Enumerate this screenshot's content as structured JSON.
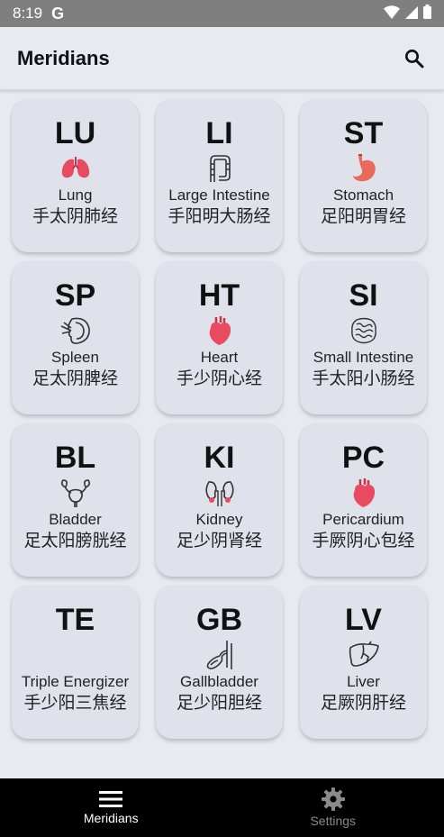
{
  "status_bar": {
    "time": "8:19",
    "notification": "G"
  },
  "app_bar": {
    "title": "Meridians"
  },
  "meridians": [
    {
      "code": "LU",
      "name": "Lung",
      "chinese": "手太阴肺经",
      "icon": "lungs-icon"
    },
    {
      "code": "LI",
      "name": "Large Intestine",
      "chinese": "手阳明大肠经",
      "icon": "large-intestine-icon"
    },
    {
      "code": "ST",
      "name": "Stomach",
      "chinese": "足阳明胃经",
      "icon": "stomach-icon"
    },
    {
      "code": "SP",
      "name": "Spleen",
      "chinese": "足太阴脾经",
      "icon": "spleen-icon"
    },
    {
      "code": "HT",
      "name": "Heart",
      "chinese": "手少阴心经",
      "icon": "heart-icon"
    },
    {
      "code": "SI",
      "name": "Small Intestine",
      "chinese": "手太阳小肠经",
      "icon": "small-intestine-icon"
    },
    {
      "code": "BL",
      "name": "Bladder",
      "chinese": "足太阳膀胱经",
      "icon": "bladder-icon"
    },
    {
      "code": "KI",
      "name": "Kidney",
      "chinese": "足少阴肾经",
      "icon": "kidney-icon"
    },
    {
      "code": "PC",
      "name": "Pericardium",
      "chinese": "手厥阴心包经",
      "icon": "pericardium-icon"
    },
    {
      "code": "TE",
      "name": "Triple Energizer",
      "chinese": "手少阳三焦经",
      "icon": "none"
    },
    {
      "code": "GB",
      "name": "Gallbladder",
      "chinese": "足少阳胆经",
      "icon": "gallbladder-icon"
    },
    {
      "code": "LV",
      "name": "Liver",
      "chinese": "足厥阴肝经",
      "icon": "liver-icon"
    }
  ],
  "bottom_nav": [
    {
      "label": "Meridians",
      "icon": "menu-icon",
      "active": true
    },
    {
      "label": "Settings",
      "icon": "gear-icon",
      "active": false
    }
  ],
  "colors": {
    "background": "#e7eaf1",
    "card": "#dfe2ea",
    "organ_red": "#e84a5f",
    "nav_bg": "#000000",
    "nav_inactive": "#8a8a8a"
  }
}
